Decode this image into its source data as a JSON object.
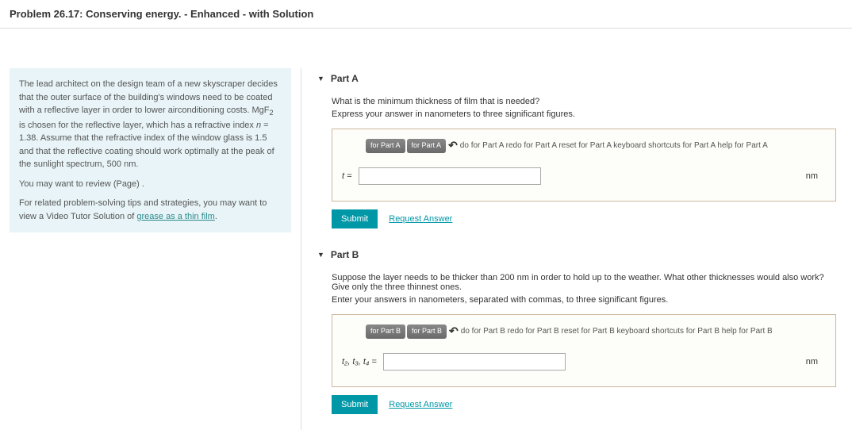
{
  "header": {
    "title": "Problem 26.17: Conserving energy. - Enhanced - with Solution"
  },
  "info": {
    "p1a": "The lead architect on the design team of a new skyscraper decides that the outer surface of the building's windows need to be coated with a reflective layer in order to lower airconditioning costs. MgF",
    "p1sub": "2",
    "p1b": " is chosen for the reflective layer, which has a refractive index ",
    "nlabel": "n",
    "p1c": " = 1.38. Assume that the refractive index of the window glass is 1.5 and that the reflective coating should work optimally at the peak of the sunlight spectrum, 500 nm.",
    "p2": "You may want to review (Page) .",
    "p3a": "For related problem-solving tips and strategies, you may want to view a Video Tutor Solution of ",
    "p3link": "grease as a thin film",
    "p3b": "."
  },
  "partA": {
    "label": "Part A",
    "question": "What is the minimum thickness of film that is needed?",
    "instruction": "Express your answer in nanometers to three significant figures.",
    "toolbar": "do for Part A  redo for Part A  reset for Part A  keyboard shortcuts for Part A  help for Part A",
    "tb_btn1": "for Part A",
    "tb_btn2": "for Part A",
    "var": "t =",
    "unit": "nm",
    "submit": "Submit",
    "request": "Request Answer"
  },
  "partB": {
    "label": "Part B",
    "question": "Suppose the layer needs to be thicker than 200 nm in order to hold up to the weather. What other thicknesses would also work? Give only the three thinnest ones.",
    "instruction": "Enter your answers in nanometers, separated with commas, to three significant figures.",
    "toolbar": "do for Part B  redo for Part B  reset for Part B  keyboard shortcuts for Part B  help for Part B",
    "tb_btn1": "for Part B",
    "tb_btn2": "for Part B",
    "var": "t₂, t₃, t₄ =",
    "unit": "nm",
    "submit": "Submit",
    "request": "Request Answer"
  }
}
